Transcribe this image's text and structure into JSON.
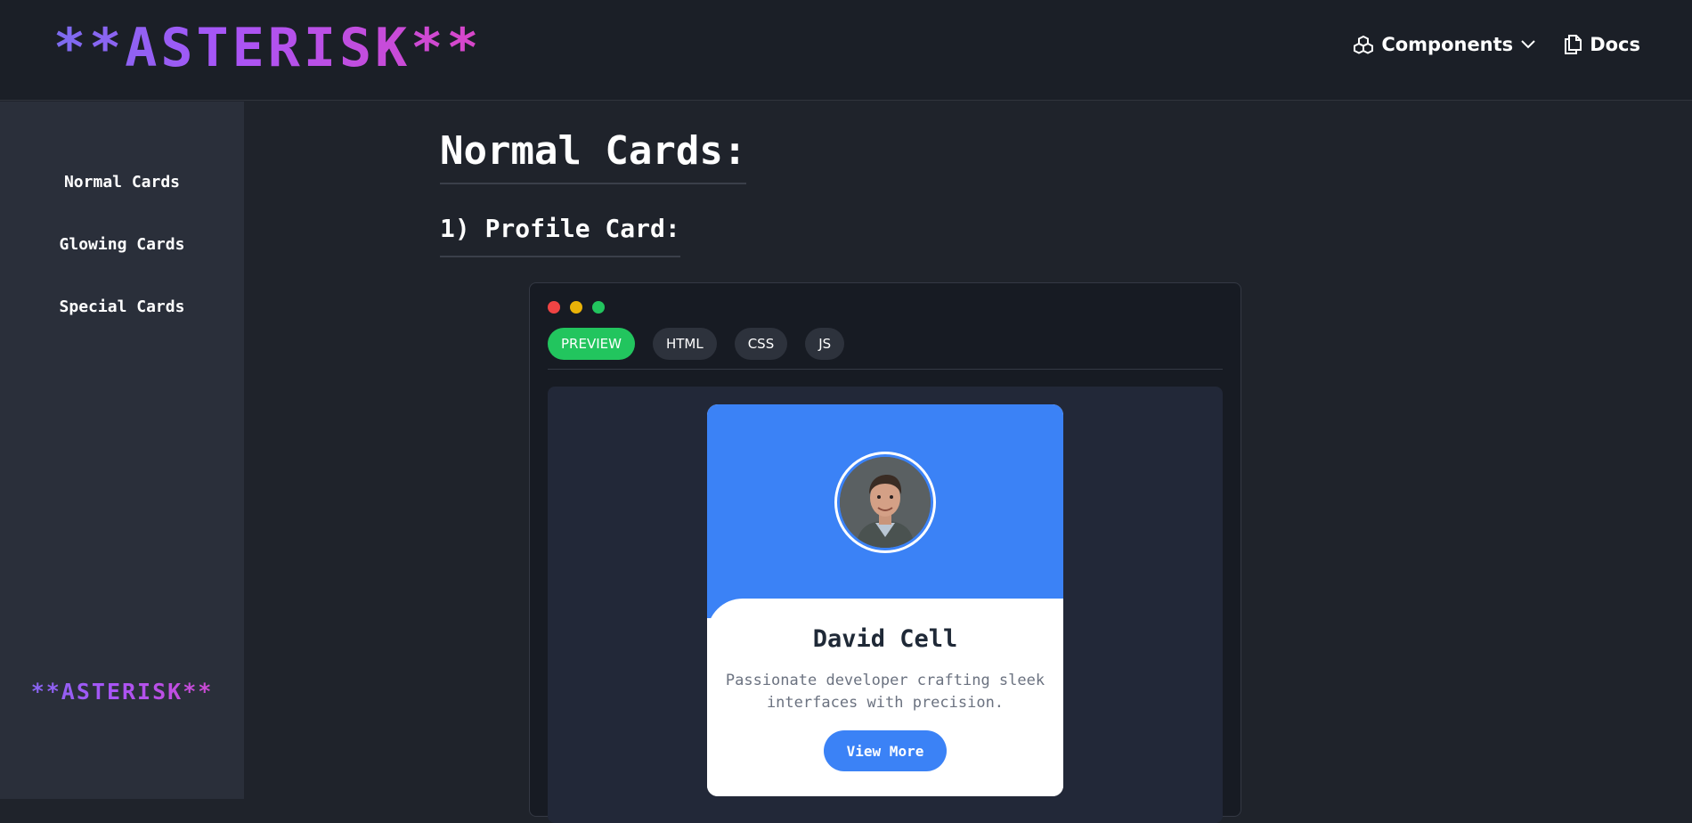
{
  "header": {
    "logo": "**ASTERISK**",
    "nav": {
      "components_label": "Components",
      "docs_label": "Docs"
    }
  },
  "sidebar": {
    "items": [
      {
        "label": "Normal Cards"
      },
      {
        "label": "Glowing Cards"
      },
      {
        "label": "Special Cards"
      }
    ],
    "footer_logo": "**ASTERISK**"
  },
  "main": {
    "title": "Normal Cards:",
    "section_title": "1) Profile Card:",
    "window": {
      "tabs": [
        {
          "label": "PREVIEW",
          "active": true
        },
        {
          "label": "HTML",
          "active": false
        },
        {
          "label": "CSS",
          "active": false
        },
        {
          "label": "JS",
          "active": false
        }
      ],
      "dot_colors": [
        "#ef4444",
        "#eab308",
        "#22c55e"
      ]
    },
    "profile_card": {
      "name": "David Cell",
      "description": "Passionate developer crafting sleek interfaces with precision.",
      "button_label": "View More",
      "accent_color": "#3b82f6"
    }
  }
}
